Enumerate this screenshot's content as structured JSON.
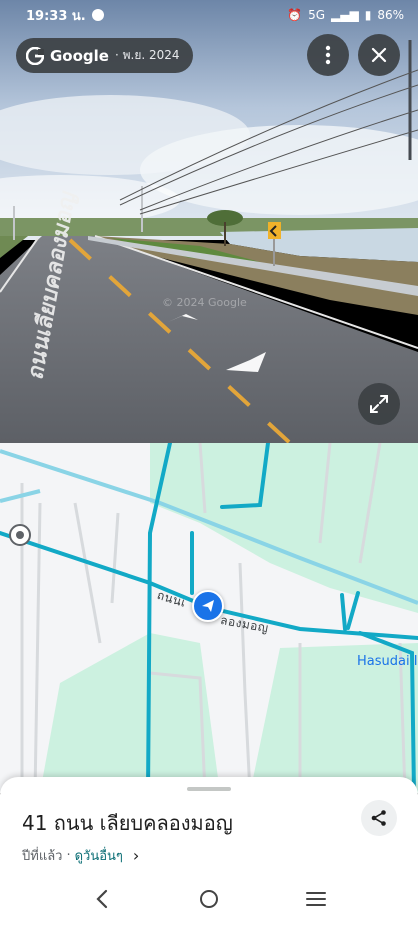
{
  "status_bar": {
    "time": "19:33 น.",
    "network": "5G",
    "battery": "86%"
  },
  "street_view": {
    "brand": "Google",
    "capture_date": "· พ.ย. 2024",
    "watermark": "© 2024 Google",
    "road_marking": "ถนนเลียบคลองมอญ",
    "icons": {
      "more": "more-vert-icon",
      "close": "close-icon",
      "expand": "fullscreen-icon"
    }
  },
  "map": {
    "road_label": "ถนนเ",
    "road_label_2": "ลองมอญ",
    "place_label": "Hasudai I",
    "colors": {
      "green_area": "#ccf1e0",
      "road_blue": "#12a9c6",
      "road_light": "#8ad4e6"
    }
  },
  "sheet": {
    "address": "41 ถนน เลียบคลองมอญ",
    "age": "ปีที่แล้ว",
    "separator": "·",
    "more_dates": "ดูวันอื่นๆ",
    "chevron": "›"
  },
  "navbar": {
    "icons": [
      "back-icon",
      "home-icon",
      "recents-icon"
    ]
  }
}
